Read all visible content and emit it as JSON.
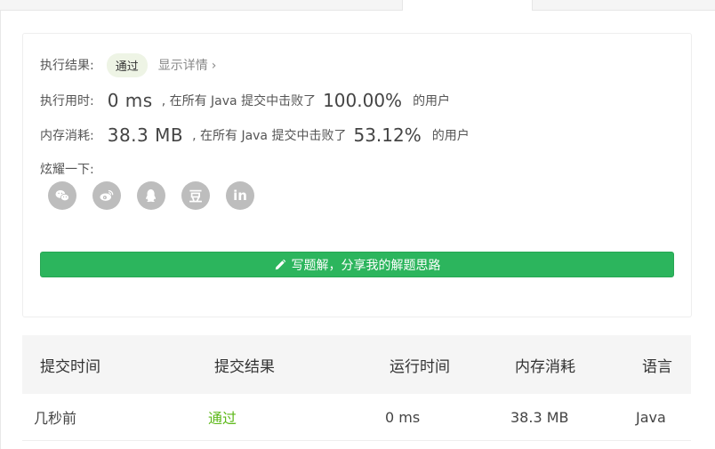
{
  "result": {
    "label": "执行结果:",
    "status": "通过",
    "details_link": "显示详情",
    "details_chevron": "›"
  },
  "runtime": {
    "label": "执行用时:",
    "value": "0 ms",
    "middle_text": ", 在所有 Java 提交中击败了",
    "percent": "100.00%",
    "tail": "的用户"
  },
  "memory": {
    "label": "内存消耗:",
    "value": "38.3 MB",
    "middle_text": ", 在所有 Java 提交中击败了",
    "percent": "53.12%",
    "tail": "的用户"
  },
  "share": {
    "label": "炫耀一下:",
    "icons": [
      "wechat-icon",
      "weibo-icon",
      "qq-icon",
      "douban-icon",
      "linkedin-icon"
    ],
    "douban_glyph": "豆",
    "linkedin_glyph": "in"
  },
  "write_solution": {
    "label": "写题解，分享我的解题思路"
  },
  "table": {
    "headers": [
      "提交时间",
      "提交结果",
      "运行时间",
      "内存消耗",
      "语言"
    ],
    "rows": [
      [
        "几秒前",
        "通过",
        "0 ms",
        "38.3 MB",
        "Java"
      ]
    ]
  },
  "colors": {
    "accent_green": "#2cb55d",
    "pass_green": "#5cb818",
    "icon_gray": "#bdbdbd"
  }
}
